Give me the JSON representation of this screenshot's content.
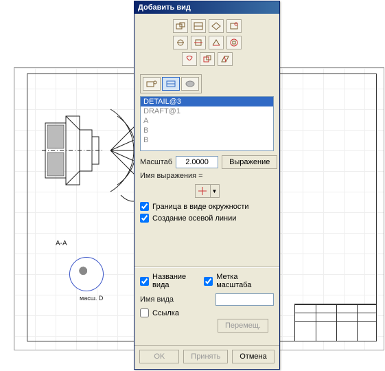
{
  "dialog": {
    "title": "Добавить вид",
    "list": {
      "items": [
        "DETAIL@3",
        "DRAFT@1",
        "A",
        "B",
        "B"
      ],
      "selected_index": 0
    },
    "scale": {
      "label": "Масштаб",
      "value": "2.0000",
      "expr_button": "Выражение",
      "expr_label": "Имя выражения ="
    },
    "options": {
      "circle_boundary": "Граница в виде окружности",
      "circle_boundary_checked": true,
      "centerline": "Создание осевой линии",
      "centerline_checked": true,
      "view_name_label": "Название вида",
      "view_name_checked": true,
      "scale_label_label": "Метка масштаба",
      "scale_label_checked": true
    },
    "viewname": {
      "label": "Имя вида",
      "value": ""
    },
    "link": {
      "label": "Ссылка",
      "checked": false
    },
    "move_button": "Перемещ.",
    "buttons": {
      "ok": "OK",
      "apply": "Принять",
      "cancel": "Отмена"
    }
  },
  "canvas": {
    "section_label": "A-A",
    "detail_label": "масш. D"
  }
}
